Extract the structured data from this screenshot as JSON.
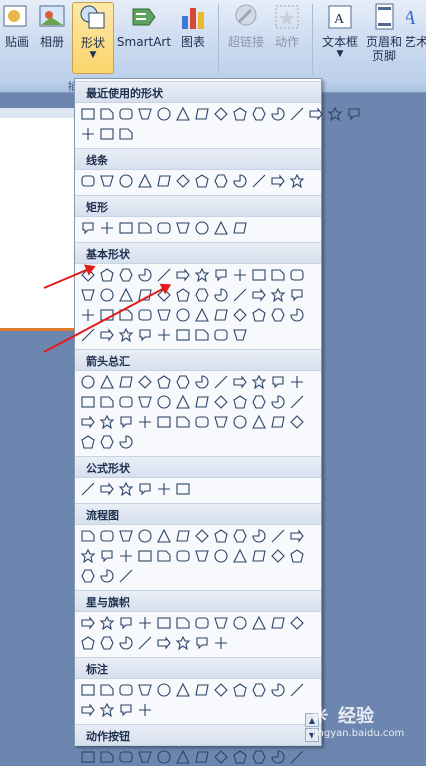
{
  "ribbon": {
    "buttons": [
      {
        "id": "clipart",
        "label": "剪贴画",
        "visible": "贴画"
      },
      {
        "id": "album",
        "label": "相册"
      },
      {
        "id": "shapes",
        "label": "形状"
      },
      {
        "id": "smartart",
        "label": "SmartArt"
      },
      {
        "id": "chart",
        "label": "图表"
      },
      {
        "id": "hyperlink",
        "label": "超链接"
      },
      {
        "id": "action",
        "label": "动作"
      },
      {
        "id": "textbox",
        "label": "文本框"
      },
      {
        "id": "header_footer",
        "label": "页眉和\n页脚",
        "l1": "页眉和",
        "l2": "页脚"
      },
      {
        "id": "wordart",
        "label": "艺术",
        "visible": "艺术"
      }
    ],
    "group_caption_partial": "插",
    "accent_active": "#fbd46b"
  },
  "gallery": {
    "categories": [
      {
        "id": "recent",
        "title": "最近使用的形状",
        "rows": [
          15,
          3
        ]
      },
      {
        "id": "lines",
        "title": "线条",
        "rows": [
          12
        ]
      },
      {
        "id": "rect",
        "title": "矩形",
        "rows": [
          9
        ]
      },
      {
        "id": "basic",
        "title": "基本形状",
        "rows": [
          12,
          12,
          12,
          9
        ]
      },
      {
        "id": "block_arrows",
        "title": "箭头总汇",
        "rows": [
          12,
          12,
          12,
          3
        ]
      },
      {
        "id": "equation",
        "title": "公式形状",
        "rows": [
          6
        ]
      },
      {
        "id": "flowchart",
        "title": "流程图",
        "rows": [
          12,
          12,
          3
        ]
      },
      {
        "id": "stars",
        "title": "星与旗帜",
        "rows": [
          12,
          8
        ]
      },
      {
        "id": "callouts",
        "title": "标注",
        "rows": [
          12,
          4
        ]
      },
      {
        "id": "action_buttons",
        "title": "动作按钮",
        "rows": [
          12
        ]
      }
    ]
  },
  "annotations": {
    "arrow_color": "#e21b1b"
  },
  "watermark": {
    "brand": "经验",
    "url": "jingyan.baidu.com"
  }
}
